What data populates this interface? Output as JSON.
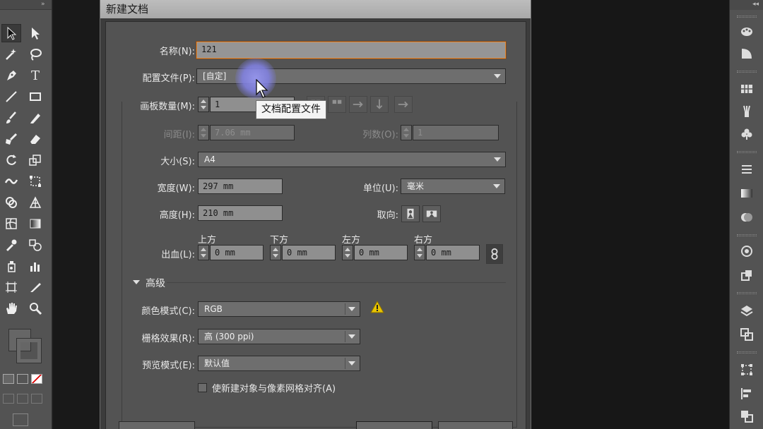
{
  "dialog": {
    "title": "新建文档",
    "name_label": "名称(N):",
    "name_value": "121",
    "profile_label": "配置文件(P):",
    "profile_value": "[自定]",
    "artboards_label": "画板数量(M):",
    "artboards_value": "1",
    "spacing_label": "间距(I):",
    "spacing_value": "7.06 mm",
    "columns_label": "列数(O):",
    "columns_value": "1",
    "size_label": "大小(S):",
    "size_value": "A4",
    "width_label": "宽度(W):",
    "width_value": "297 mm",
    "units_label": "单位(U):",
    "units_value": "毫米",
    "height_label": "高度(H):",
    "height_value": "210 mm",
    "orientation_label": "取向:",
    "bleed_label": "出血(L):",
    "bleed_top_label": "上方",
    "bleed_top_value": "0 mm",
    "bleed_bottom_label": "下方",
    "bleed_bottom_value": "0 mm",
    "bleed_left_label": "左方",
    "bleed_left_value": "0 mm",
    "bleed_right_label": "右方",
    "bleed_right_value": "0 mm",
    "advanced_label": "高级",
    "color_mode_label": "颜色模式(C):",
    "color_mode_value": "RGB",
    "raster_label": "栅格效果(R):",
    "raster_value": "高 (300 ppi)",
    "preview_label": "预览模式(E):",
    "preview_value": "默认值",
    "align_checkbox_label": "使新建对象与像素网格对齐(A)",
    "tooltip_text": "文档配置文件"
  },
  "tools_panel": {
    "collapse": "»"
  },
  "right_panel": {
    "collapse": "◂◂"
  },
  "colors": {
    "warning": "#e8c400",
    "focus_border": "#e28b3a",
    "cursor_halo": "#8c8ce6"
  }
}
